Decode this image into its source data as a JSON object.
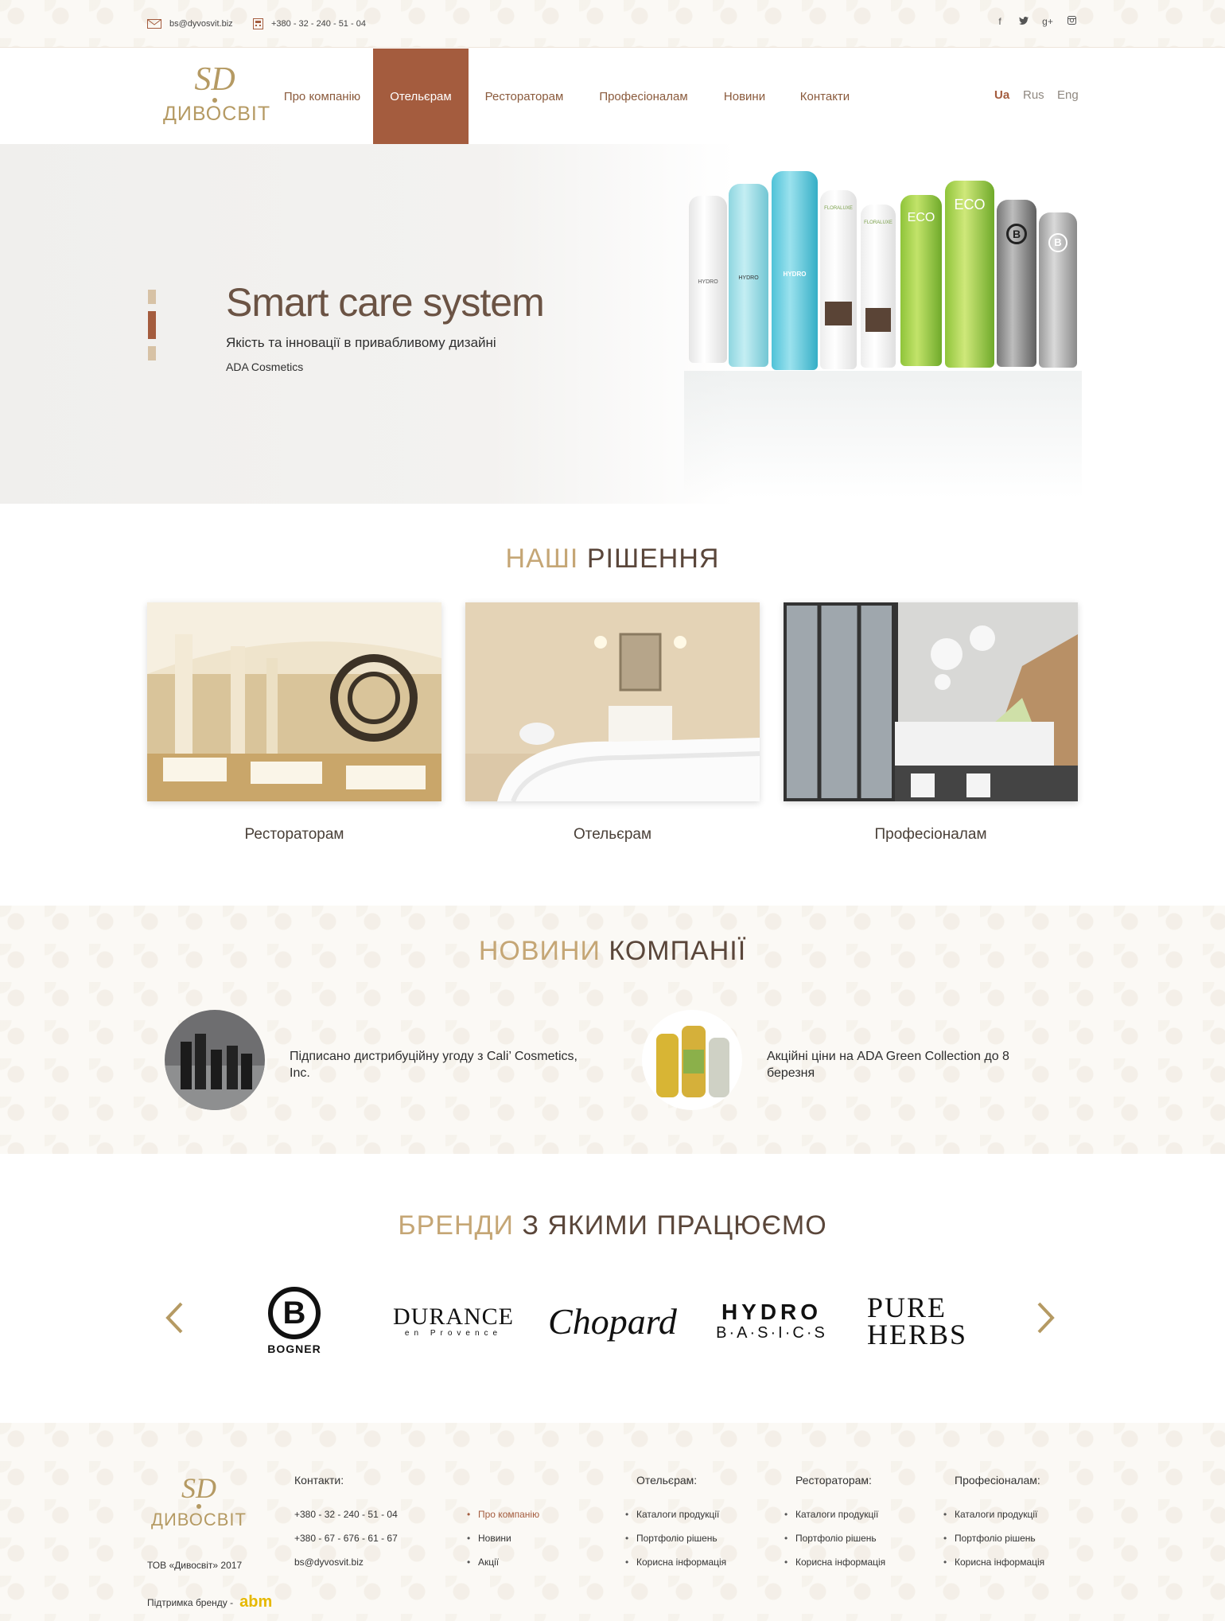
{
  "topbar": {
    "email": "bs@dyvosvit.biz",
    "phone": "+380 - 32 - 240 - 51 - 04",
    "social": [
      "f",
      "t",
      "g+",
      "ig"
    ]
  },
  "header": {
    "logo_monogram": "SD",
    "logo_name": "ДИВОСВІТ",
    "nav": [
      "Про компанію",
      "Отельєрам",
      "Ресторато­рам",
      "Професіоналам",
      "Новини",
      "Контакти"
    ],
    "active_nav": "Отельєрам",
    "languages": [
      "Ua",
      "Rus",
      "Eng"
    ],
    "active_language": "Ua"
  },
  "hero": {
    "title": "Smart care system",
    "subtitle": "Якість та інновації в привабливому дизайні",
    "brand": "ADA Cosmetics",
    "bottle_labels": [
      "HYDRO",
      "HYDRO",
      "HYDRO",
      "FLORALUXE",
      "FLORALUXE",
      "ECO",
      "ECO",
      "B",
      "B"
    ]
  },
  "solutions": {
    "title_a": "НАШІ",
    "title_b": "РІШЕННЯ",
    "items": [
      "Рестораторам",
      "Отельєрам",
      "Професіоналам"
    ]
  },
  "news": {
    "title_a": "НОВИНИ",
    "title_b": "КОМПАНІЇ",
    "items": [
      "Підписано дистрибуційну угоду з Cali’ Cosmetics, Inc.",
      "Акційні ціни на ADA Green Collection до 8 березня"
    ]
  },
  "brands": {
    "title_a": "БРЕНДИ",
    "title_b": "З ЯКИМИ ПРАЦЮЄМО",
    "bogner_letter": "B",
    "bogner": "BOGNER",
    "durance": "DURANCE",
    "durance_sub": "en Provence",
    "chopard": "Chopard",
    "hydro_1": "HYDRO",
    "hydro_2": "B·A·S·I·C·S",
    "pure_1": "PURE",
    "pure_2": "HERBS",
    "prev": "‹",
    "next": "›"
  },
  "footer": {
    "logo_monogram": "SD",
    "logo_name": "ДИВОСВІТ",
    "copyright": "ТОВ «Дивосвіт» 2017",
    "support": "Підтримка бренду -",
    "support_brand": "abm",
    "contacts_head": "Контакти:",
    "contacts": [
      "+380 - 32 - 240 - 51 - 04",
      "+380 - 67 - 676 - 61 - 67",
      "bs@dyvosvit.biz"
    ],
    "links": [
      "Про компанію",
      "Новини",
      "Акції"
    ],
    "columns": [
      {
        "head": "Отельєрам:",
        "items": [
          "Каталоги продукції",
          "Портфоліо рішень",
          "Корисна інформація"
        ]
      },
      {
        "head": "Рестораторам:",
        "items": [
          "Каталоги продукції",
          "Портфоліо рішень",
          "Корисна інформація"
        ]
      },
      {
        "head": "Професіоналам:",
        "items": [
          "Каталоги продукції",
          "Портфоліо рішень",
          "Корисна інформація"
        ]
      }
    ]
  },
  "colors": {
    "accent": "#a45c3e",
    "gold": "#c5a675",
    "dark": "#5a463a"
  }
}
